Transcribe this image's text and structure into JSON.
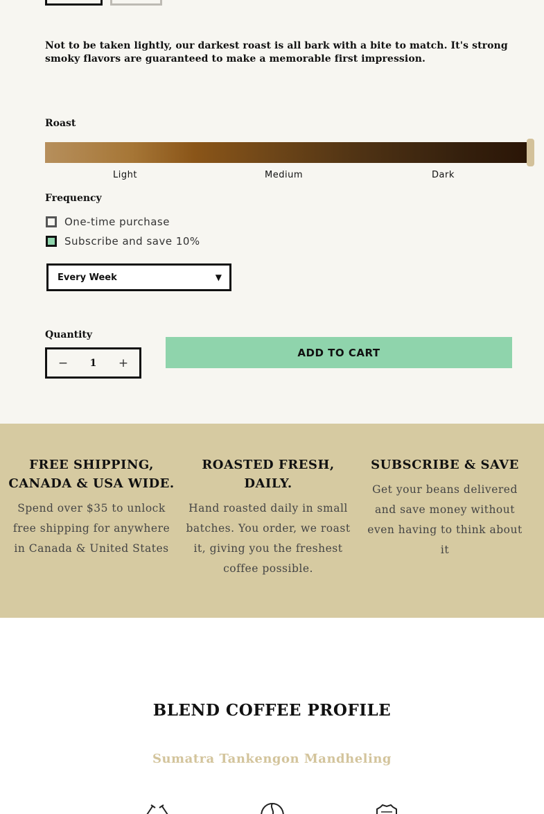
{
  "product": {
    "description": "Not to be taken lightly, our darkest roast is all bark with a bite to match. It's strong smoky flavors are guaranteed to make a memorable first impression."
  },
  "roast": {
    "label": "Roast",
    "level_fraction": 1.0,
    "ticks": [
      "Light",
      "Medium",
      "Dark"
    ]
  },
  "frequency": {
    "label": "Frequency",
    "options": [
      {
        "label": "One-time purchase",
        "checked": false
      },
      {
        "label": "Subscribe and save 10%",
        "checked": true
      }
    ],
    "select_value": "Every Week"
  },
  "quantity": {
    "label": "Quantity",
    "value": "1",
    "minus": "−",
    "plus": "+"
  },
  "cart": {
    "button_label": "ADD TO CART"
  },
  "features": [
    {
      "title": "FREE SHIPPING, CANADA & USA WIDE.",
      "text": "Spend over $35 to unlock free shipping for anywhere in Canada & United States"
    },
    {
      "title": "ROASTED FRESH, DAILY.",
      "text": "Hand roasted daily in small batches. You order, we roast it, giving you the freshest coffee possible."
    },
    {
      "title": "SUBSCRIBE & SAVE",
      "text": "Get your beans delivered and save money without even having to think about it"
    }
  ],
  "profile": {
    "title": "BLEND COFFEE PROFILE",
    "subtitle": "Sumatra Tankengon Mandheling"
  },
  "icons": [
    "tools-icon",
    "coffee-bean-icon",
    "badge-icon"
  ],
  "colors": {
    "background": "#f7f6f1",
    "accent_green": "#8fd4ac",
    "feature_band": "#d6caa1",
    "subtitle_gold": "#d3c49c"
  }
}
